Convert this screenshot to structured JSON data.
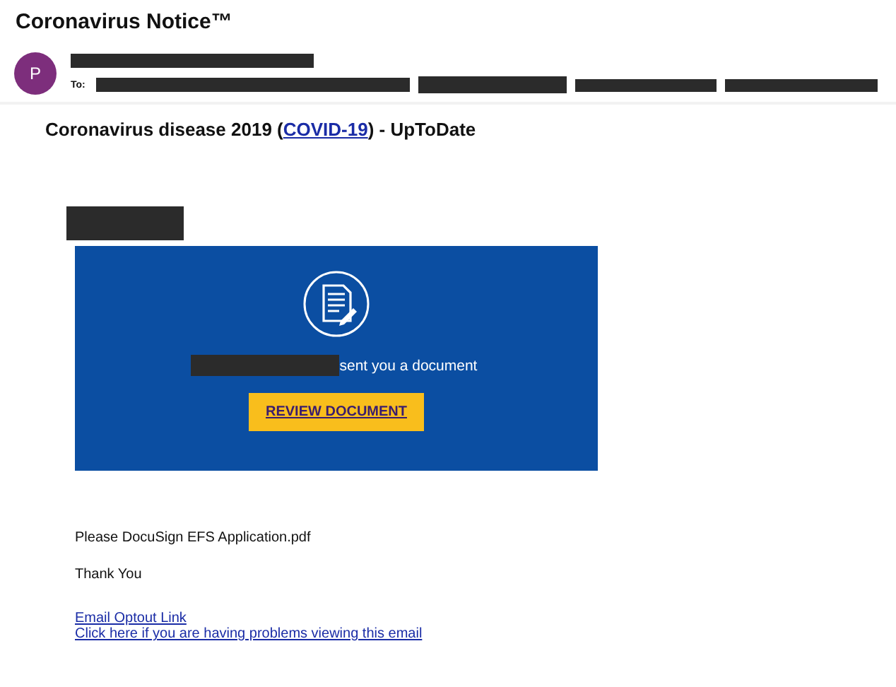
{
  "email": {
    "subject": "Coronavirus Notice™",
    "avatar_initial": "P",
    "to_label": "To:"
  },
  "heading": {
    "before": "Coronavirus disease 2019 (",
    "link": "COVID-19",
    "after": ") - UpToDate"
  },
  "card": {
    "message": "sent you a document",
    "button": "REVIEW DOCUMENT"
  },
  "body": [
    "Please DocuSign EFS Application.pdf",
    "Thank You"
  ],
  "links": [
    "Email Optout Link",
    "Click here if you are having problems viewing this email"
  ]
}
